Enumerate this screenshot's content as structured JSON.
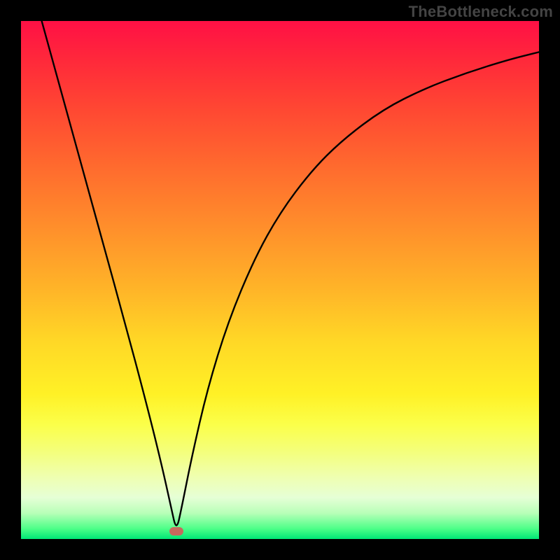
{
  "watermark": "TheBottleneck.com",
  "chart_data": {
    "type": "line",
    "title": "",
    "xlabel": "",
    "ylabel": "",
    "xlim": [
      0,
      1
    ],
    "ylim": [
      0,
      1
    ],
    "grid": false,
    "legend": false,
    "background_gradient": {
      "top": "#ff1045",
      "mid": "#ffd826",
      "bottom": "#00e676"
    },
    "series": [
      {
        "name": "bottleneck-curve",
        "stroke": "#000000",
        "x": [
          0.04,
          0.08,
          0.12,
          0.16,
          0.2,
          0.24,
          0.27,
          0.29,
          0.3,
          0.31,
          0.33,
          0.36,
          0.4,
          0.45,
          0.5,
          0.56,
          0.62,
          0.7,
          0.78,
          0.86,
          0.94,
          1.0
        ],
        "y": [
          1.0,
          0.855,
          0.71,
          0.565,
          0.42,
          0.27,
          0.15,
          0.06,
          0.015,
          0.06,
          0.16,
          0.29,
          0.42,
          0.54,
          0.63,
          0.71,
          0.77,
          0.83,
          0.87,
          0.9,
          0.925,
          0.94
        ]
      }
    ],
    "marker": {
      "name": "optimal-point",
      "x": 0.3,
      "y": 0.015,
      "color": "#c66a5d"
    }
  }
}
